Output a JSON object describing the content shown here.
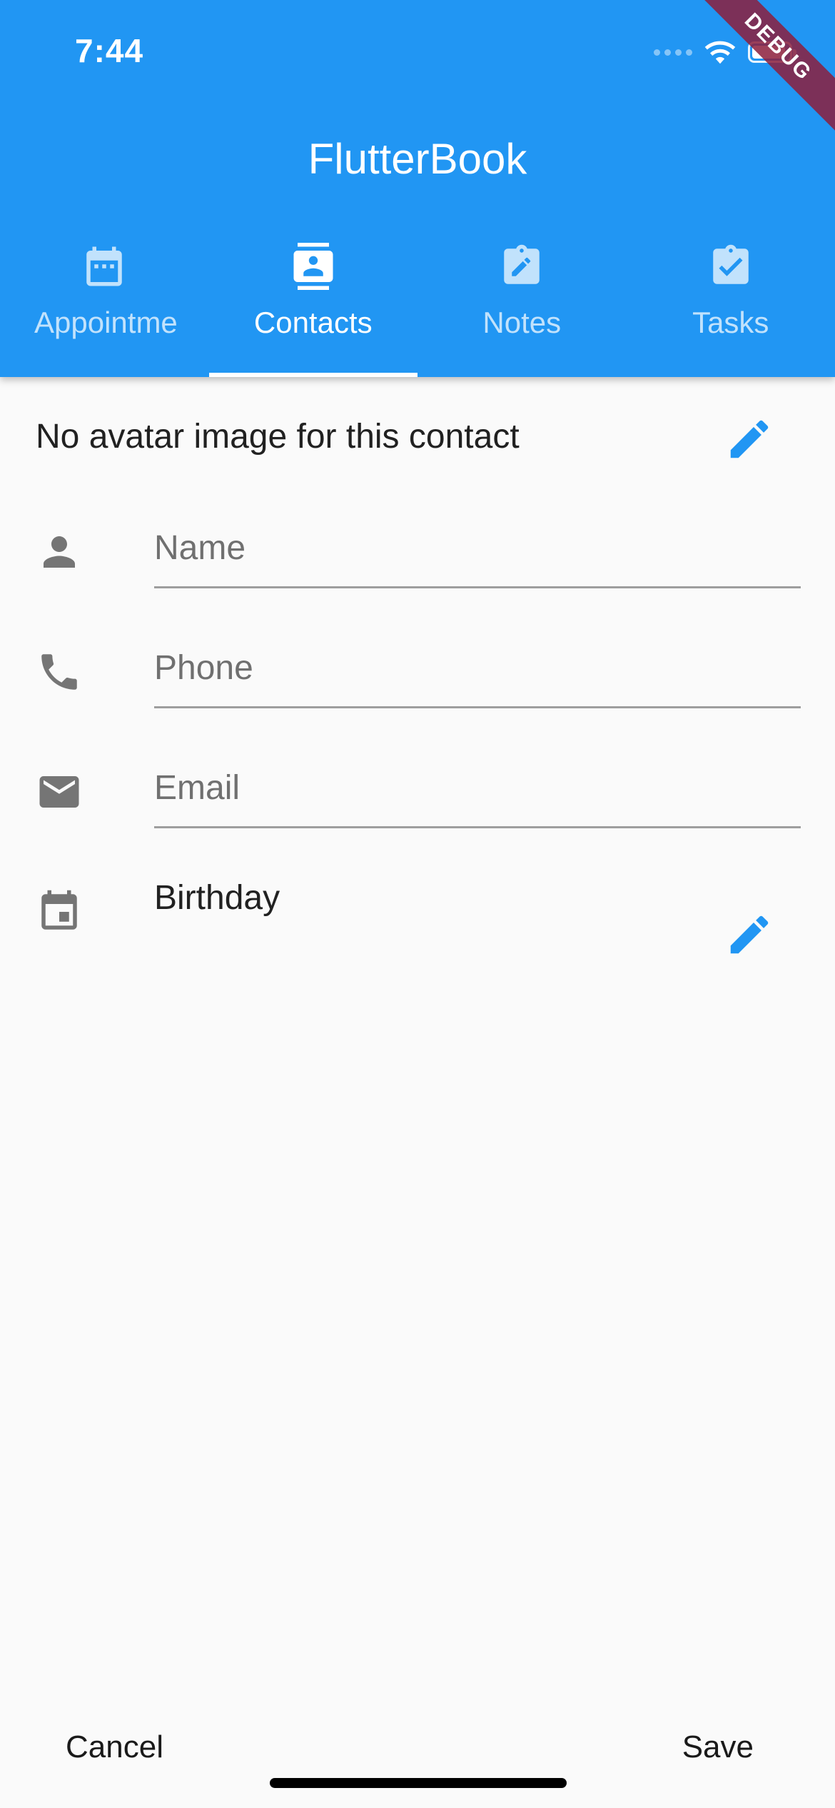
{
  "status_bar": {
    "time": "7:44"
  },
  "debug_banner": "DEBUG",
  "app": {
    "title": "FlutterBook",
    "accent_color": "#2196f3"
  },
  "tabs": [
    {
      "label": "Appointments",
      "icon": "calendar-icon",
      "active": false
    },
    {
      "label": "Contacts",
      "icon": "contacts-icon",
      "active": true
    },
    {
      "label": "Notes",
      "icon": "note-edit-icon",
      "active": false
    },
    {
      "label": "Tasks",
      "icon": "task-check-icon",
      "active": false
    }
  ],
  "form": {
    "avatar_text": "No avatar image for this contact",
    "name_placeholder": "Name",
    "phone_placeholder": "Phone",
    "email_placeholder": "Email",
    "birthday_label": "Birthday"
  },
  "actions": {
    "cancel": "Cancel",
    "save": "Save"
  }
}
